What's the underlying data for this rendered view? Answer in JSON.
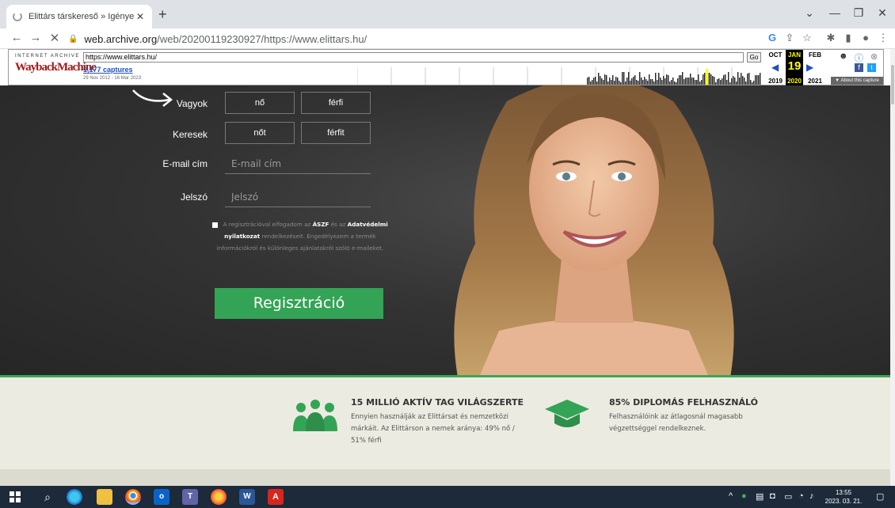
{
  "browser": {
    "tab_title": "Elittárs társkereső » Igényes, dipl",
    "new_tab": "+",
    "url_domain": "web.archive.org",
    "url_path": "/web/20200119230927/https://www.elittars.hu/"
  },
  "wayback": {
    "logo_top": "INTERNET ARCHIVE",
    "logo_main": "WaybackMachine",
    "url_value": "https://www.elittars.hu/",
    "go_label": "Go",
    "captures": "1,177 captures",
    "range": "29 Nov 2012 - 16 Mar 2023",
    "months": [
      "OCT",
      "JAN",
      "FEB"
    ],
    "day": "19",
    "years": [
      "2019",
      "2020",
      "2021"
    ],
    "about": "▼ About this capture"
  },
  "form": {
    "vagyok_label": "Vagyok",
    "keresek_label": "Keresek",
    "vagyok_options": [
      "nő",
      "férfi"
    ],
    "keresek_options": [
      "nőt",
      "férfit"
    ],
    "email_label": "E-mail cím",
    "email_placeholder": "E-mail cím",
    "password_label": "Jelszó",
    "password_placeholder": "Jelszó",
    "terms_part1": " A regisztrációval elfogadom az ",
    "terms_aszf": "ÁSZF",
    "terms_part2": " és az ",
    "terms_adatv": "Adatvédelmi nyilatkozat",
    "terms_part3": " rendelkezéseit. Engedélyezem a termék információkról és különleges ajánlatokról szóló e-maileket.",
    "register_button": "Regisztráció"
  },
  "features": [
    {
      "icon": "people-group-icon",
      "title": "15 MILLIÓ AKTÍV TAG VILÁGSZERTE",
      "text": "Ennyien használják az Elittársat és nemzetközi márkáit. Az Elittárson a nemek aránya: 49% nő / 51% férfi"
    },
    {
      "icon": "graduation-cap-icon",
      "title": "85% DIPLOMÁS FELHASZNÁLÓ",
      "text": "Felhasználóink az átlagosnál magasabb végzettséggel rendelkeznek."
    }
  ],
  "taskbar": {
    "time": "13:55",
    "date": "2023. 03. 21."
  },
  "colors": {
    "accent_green": "#33a455",
    "hero_bg": "#333333",
    "features_bg": "#ecebe1"
  }
}
